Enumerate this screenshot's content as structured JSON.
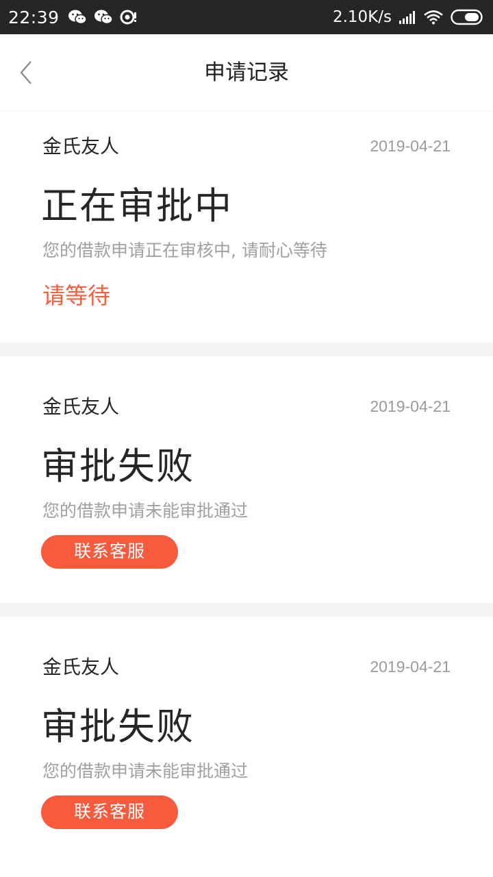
{
  "status_bar": {
    "time": "22:39",
    "network_speed": "2.10K/s",
    "icons_left": [
      "wechat-icon",
      "wechat-icon",
      "eye-notification-icon"
    ],
    "icons_right": [
      "signal-icon",
      "wifi-icon",
      "battery-icon"
    ]
  },
  "header": {
    "title": "申请记录",
    "back_icon": "chevron-left-icon"
  },
  "records": [
    {
      "name": "金氏友人",
      "date": "2019-04-21",
      "status": "正在审批中",
      "description": "您的借款申请正在审核中, 请耐心等待",
      "action_text": "请等待"
    },
    {
      "name": "金氏友人",
      "date": "2019-04-21",
      "status": "审批失败",
      "description": "您的借款申请未能审批通过",
      "button_label": "联系客服"
    },
    {
      "name": "金氏友人",
      "date": "2019-04-21",
      "status": "审批失败",
      "description": "您的借款申请未能审批通过",
      "button_label": "联系客服"
    }
  ],
  "colors": {
    "accent": "#f75a3c",
    "status_bar_bg": "#262626",
    "separator": "#f5f5f5"
  }
}
